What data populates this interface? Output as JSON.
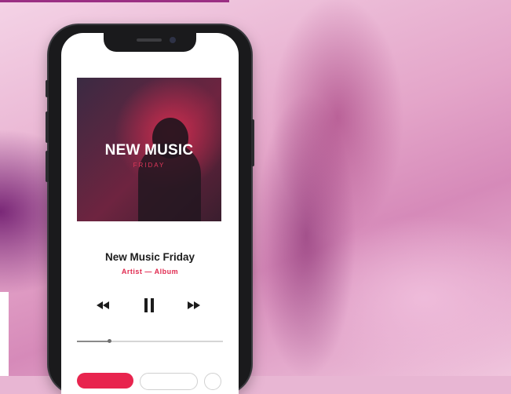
{
  "album": {
    "cover_title": "NEW MUSIC",
    "cover_subtitle": "FRIDAY"
  },
  "track": {
    "title": "New Music Friday",
    "meta": "Artist — Album"
  },
  "controls": {
    "rewind_icon": "rewind-icon",
    "pause_icon": "pause-icon",
    "forward_icon": "fast-forward-icon"
  },
  "playback": {
    "progress": 0.22
  },
  "colors": {
    "accent": "#e0294f",
    "background": "#e4a5c9"
  }
}
